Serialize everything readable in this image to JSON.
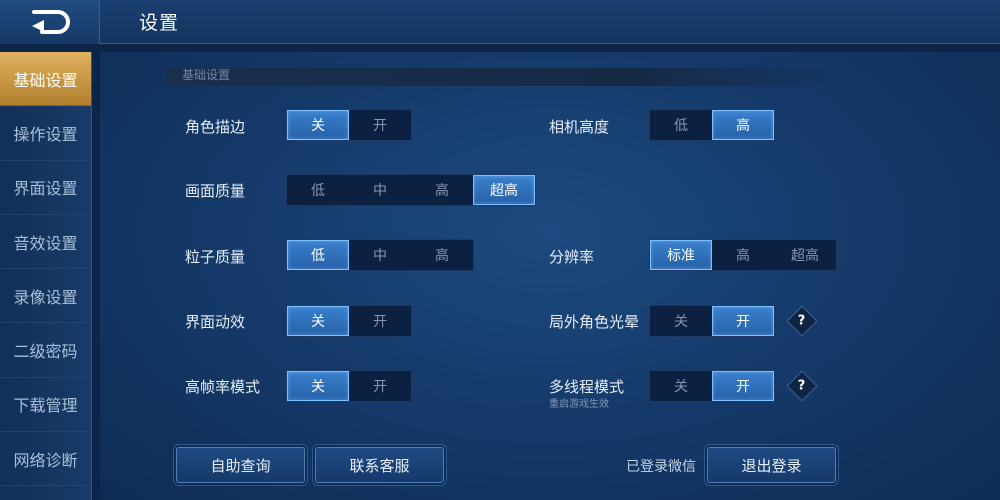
{
  "header": {
    "title": "设置",
    "back_icon": "back-arrow-icon"
  },
  "sidebar": {
    "items": [
      {
        "label": "基础设置",
        "active": true
      },
      {
        "label": "操作设置",
        "active": false
      },
      {
        "label": "界面设置",
        "active": false
      },
      {
        "label": "音效设置",
        "active": false
      },
      {
        "label": "录像设置",
        "active": false
      },
      {
        "label": "二级密码",
        "active": false
      },
      {
        "label": "下载管理",
        "active": false
      },
      {
        "label": "网络诊断",
        "active": false
      }
    ]
  },
  "section": {
    "title": "基础设置"
  },
  "settings": {
    "character_outline": {
      "label": "角色描边",
      "options": [
        "关",
        "开"
      ],
      "selected": 0
    },
    "camera_height": {
      "label": "相机高度",
      "options": [
        "低",
        "高"
      ],
      "selected": 1
    },
    "graphics_quality": {
      "label": "画面质量",
      "options": [
        "低",
        "中",
        "高",
        "超高"
      ],
      "selected": 3
    },
    "particle_quality": {
      "label": "粒子质量",
      "options": [
        "低",
        "中",
        "高"
      ],
      "selected": 0
    },
    "resolution": {
      "label": "分辨率",
      "options": [
        "标准",
        "高",
        "超高"
      ],
      "selected": 0
    },
    "ui_animation": {
      "label": "界面动效",
      "options": [
        "关",
        "开"
      ],
      "selected": 0
    },
    "outgame_halo": {
      "label": "局外角色光晕",
      "options": [
        "关",
        "开"
      ],
      "selected": 1
    },
    "high_fps": {
      "label": "高帧率模式",
      "options": [
        "关",
        "开"
      ],
      "selected": 0
    },
    "multithread": {
      "label": "多线程模式",
      "sublabel": "重启游戏生效",
      "options": [
        "关",
        "开"
      ],
      "selected": 1
    }
  },
  "help_icon": {
    "glyph": "?"
  },
  "footer": {
    "self_service": "自助查询",
    "contact_support": "联系客服",
    "wechat_status": "已登录微信",
    "logout": "退出登录"
  },
  "colors": {
    "accent_gold": "#d9a94f",
    "selected_blue": "#3a80cc",
    "background": "#0d2548"
  }
}
